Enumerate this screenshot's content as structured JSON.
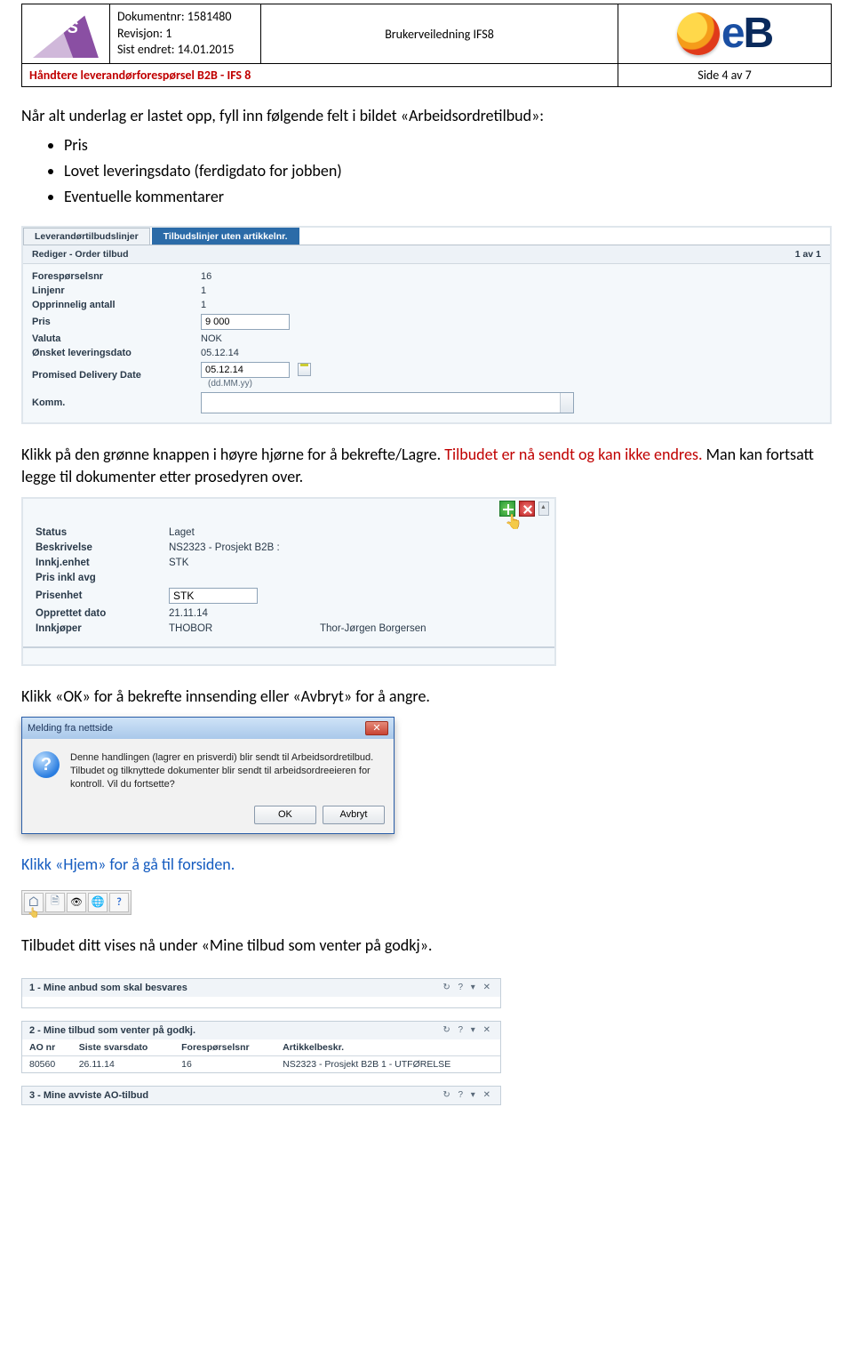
{
  "header": {
    "meta_line1": "Dokumentnr: 1581480",
    "meta_line2": "Revisjon: 1",
    "meta_line3": "Sist endret: 14.01.2015",
    "title": "Brukerveiledning IFS8",
    "doc_title": "Håndtere leverandørforespørsel B2B - IFS 8",
    "page_info": "Side 4 av 7"
  },
  "intro": {
    "text": "Når alt underlag er lastet opp, fyll inn følgende felt i bildet «Arbeidsordretilbud»:",
    "bullets": [
      "Pris",
      "Lovet leveringsdato (ferdigdato for jobben)",
      "Eventuelle kommentarer"
    ]
  },
  "shot1": {
    "tab1": "Leverandørtilbudslinjer",
    "tab2": "Tilbudslinjer uten artikkelnr.",
    "subbar_left": "Rediger - Order tilbud",
    "subbar_right": "1 av 1",
    "rows": {
      "forespnr_lbl": "Forespørselsnr",
      "forespnr_val": "16",
      "linjenr_lbl": "Linjenr",
      "linjenr_val": "1",
      "antall_lbl": "Opprinnelig antall",
      "antall_val": "1",
      "pris_lbl": "Pris",
      "pris_val": "9 000",
      "valuta_lbl": "Valuta",
      "valuta_val": "NOK",
      "onsket_lbl": "Ønsket leveringsdato",
      "onsket_val": "05.12.14",
      "promised_lbl": "Promised Delivery Date",
      "promised_val": "05.12.14",
      "promised_hint": "(dd.MM.yy)",
      "komm_lbl": "Komm."
    }
  },
  "para1_a": "Klikk på den grønne knappen i høyre hjørne for å bekrefte/Lagre. ",
  "para1_b": "Tilbudet er nå sendt og kan ikke endres.",
  "para1_c": " Man kan fortsatt legge til dokumenter etter prosedyren over.",
  "shot2": {
    "status_lbl": "Status",
    "status_val": "Laget",
    "beskr_lbl": "Beskrivelse",
    "beskr_val": "NS2323 - Prosjekt B2B :",
    "enhet_lbl": "Innkj.enhet",
    "enhet_val": "STK",
    "prisavg_lbl": "Pris inkl avg",
    "prisavg_val": "",
    "prisenhet_lbl": "Prisenhet",
    "prisenhet_val": "STK",
    "oppdato_lbl": "Opprettet dato",
    "oppdato_val": "21.11.14",
    "innkj_lbl": "Innkjøper",
    "innkj_val": "THOBOR",
    "innkj_name": "Thor-Jørgen Borgersen"
  },
  "para2": "Klikk «OK» for å bekrefte innsending eller «Avbryt» for å angre.",
  "dialog": {
    "title": "Melding fra nettside",
    "msg": "Denne handlingen (lagrer en prisverdi) blir sendt til Arbeidsordretilbud. Tilbudet og tilknyttede dokumenter blir sendt til arbeidsordreeieren for kontroll. Vil du fortsette?",
    "ok": "OK",
    "cancel": "Avbryt"
  },
  "para3": "Klikk «Hjem» for å gå til forsiden.",
  "para4": "Tilbudet ditt vises nå under «Mine tilbud som venter på godkj».",
  "panels": {
    "p1": "1 - Mine anbud som skal besvares",
    "p2": "2 - Mine tilbud som venter på godkj.",
    "p3": "3 - Mine avviste AO-tilbud",
    "controls": "↻  ?  ▾  ✕",
    "cols": {
      "ao": "AO nr",
      "siste": "Siste svarsdato",
      "fnr": "Forespørselsnr",
      "art": "Artikkelbeskr."
    },
    "row": {
      "ao": "80560",
      "siste": "26.11.14",
      "fnr": "16",
      "art": "NS2323 - Prosjekt B2B 1 - UTFØRELSE"
    }
  }
}
